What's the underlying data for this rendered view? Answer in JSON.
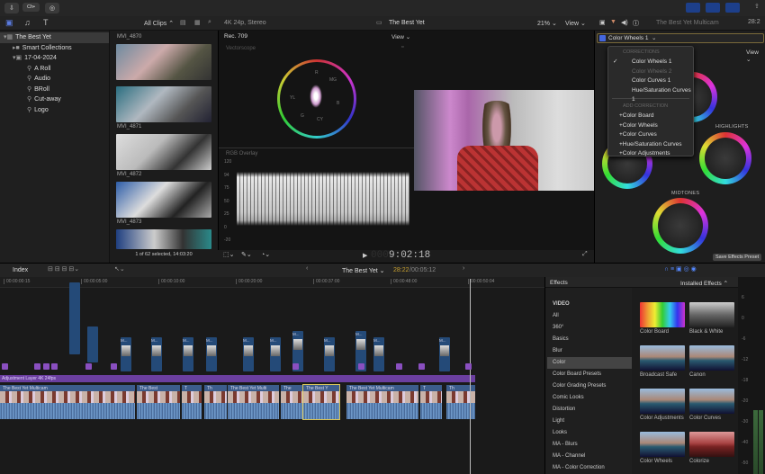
{
  "toolbar": {
    "import_icon": "download-icon",
    "keywords_label": "Ch•",
    "background_tasks_icon": "checkmark-circle-icon"
  },
  "libraries": {
    "items": [
      {
        "label": "The Best Yet",
        "level": 0,
        "selected": true
      },
      {
        "label": "Smart Collections",
        "level": 1
      },
      {
        "label": "17-04-2024",
        "level": 1
      },
      {
        "label": "A Roll",
        "level": 2
      },
      {
        "label": "Audio",
        "level": 2
      },
      {
        "label": "BRoll",
        "level": 2
      },
      {
        "label": "Cut-away",
        "level": 2
      },
      {
        "label": "Logo",
        "level": 2
      }
    ]
  },
  "browser": {
    "filter": "All Clips",
    "clips": [
      "MVI_4870",
      "MVI_4871",
      "MVI_4872",
      "MVI_4873"
    ],
    "status": "1 of 62 selected, 14:03:20"
  },
  "scopes": {
    "format": "4K 24p, Stereo",
    "standard": "Rec. 709",
    "view_label": "View",
    "vectorscope_label": "Vectorscope",
    "vector_targets": [
      "R",
      "MG",
      "B",
      "CY",
      "G",
      "YL"
    ],
    "waveform_label": "RGB Overlay",
    "waveform_ticks": [
      "120",
      "94",
      "75",
      "50",
      "25",
      "0",
      "-20"
    ]
  },
  "viewer": {
    "title": "The Best Yet",
    "zoom": "21%",
    "view_label": "View",
    "timecode": "9:02:18"
  },
  "inspector": {
    "title": "The Best Yet Multicam",
    "duration": "28:2",
    "effect_selector": "Color Wheels 1",
    "view_label": "View",
    "wheel_labels": [
      "HIGHLIGHTS",
      "MIDTONES"
    ],
    "save_preset": "Save Effects Preset"
  },
  "corrections_menu": {
    "corrections_header": "CORRECTIONS",
    "corrections": [
      {
        "label": "Color Wheels 1",
        "checked": true
      },
      {
        "label": "Color Wheels 2",
        "disabled": true
      },
      {
        "label": "Color Curves 1"
      },
      {
        "label": "Hue/Saturation Curves 1"
      }
    ],
    "add_header": "ADD CORRECTION",
    "add": [
      "+Color Board",
      "+Color Wheels",
      "+Color Curves",
      "+Hue/Saturation Curves",
      "+Color Adjustments"
    ]
  },
  "timeline": {
    "index_label": "Index",
    "project": "The Best Yet",
    "position": "28:22",
    "duration": "00:05:12",
    "ruler": [
      "00:00:00:15",
      "00:00:05:00",
      "00:00:10:00",
      "00:00:20:00",
      "00:00:37:00",
      "00:00:48:00",
      "00:00:50:04"
    ],
    "adjustment_layer": "Adjustment Layer 4K 24fps",
    "clips": [
      "The Best Yet Multicam",
      "The Best",
      "T",
      "Th",
      "The Best Yet Multi",
      "The",
      "The Best Y",
      "The Best Yet Multicam",
      "T",
      "Th"
    ],
    "connected_label": "M..."
  },
  "effects": {
    "title": "Effects",
    "filter": "Installed Effects",
    "categories": [
      "VIDEO",
      "All",
      "360°",
      "Basics",
      "Blur",
      "Color",
      "Color Board Presets",
      "Color Grading Presets",
      "Comic Looks",
      "Distortion",
      "Light",
      "Looks",
      "MA - Blurs",
      "MA - Channel",
      "MA - Color Correction"
    ],
    "selected_category": "Color",
    "items": [
      "Color Board",
      "Black & White",
      "Broadcast Safe",
      "Canon",
      "Color Adjustments",
      "Color Curves",
      "Color Wheels",
      "Colorize"
    ]
  },
  "meters": {
    "ticks": [
      "6",
      "0",
      "-6",
      "-12",
      "-18",
      "-20",
      "-30",
      "-40",
      "-50"
    ]
  }
}
